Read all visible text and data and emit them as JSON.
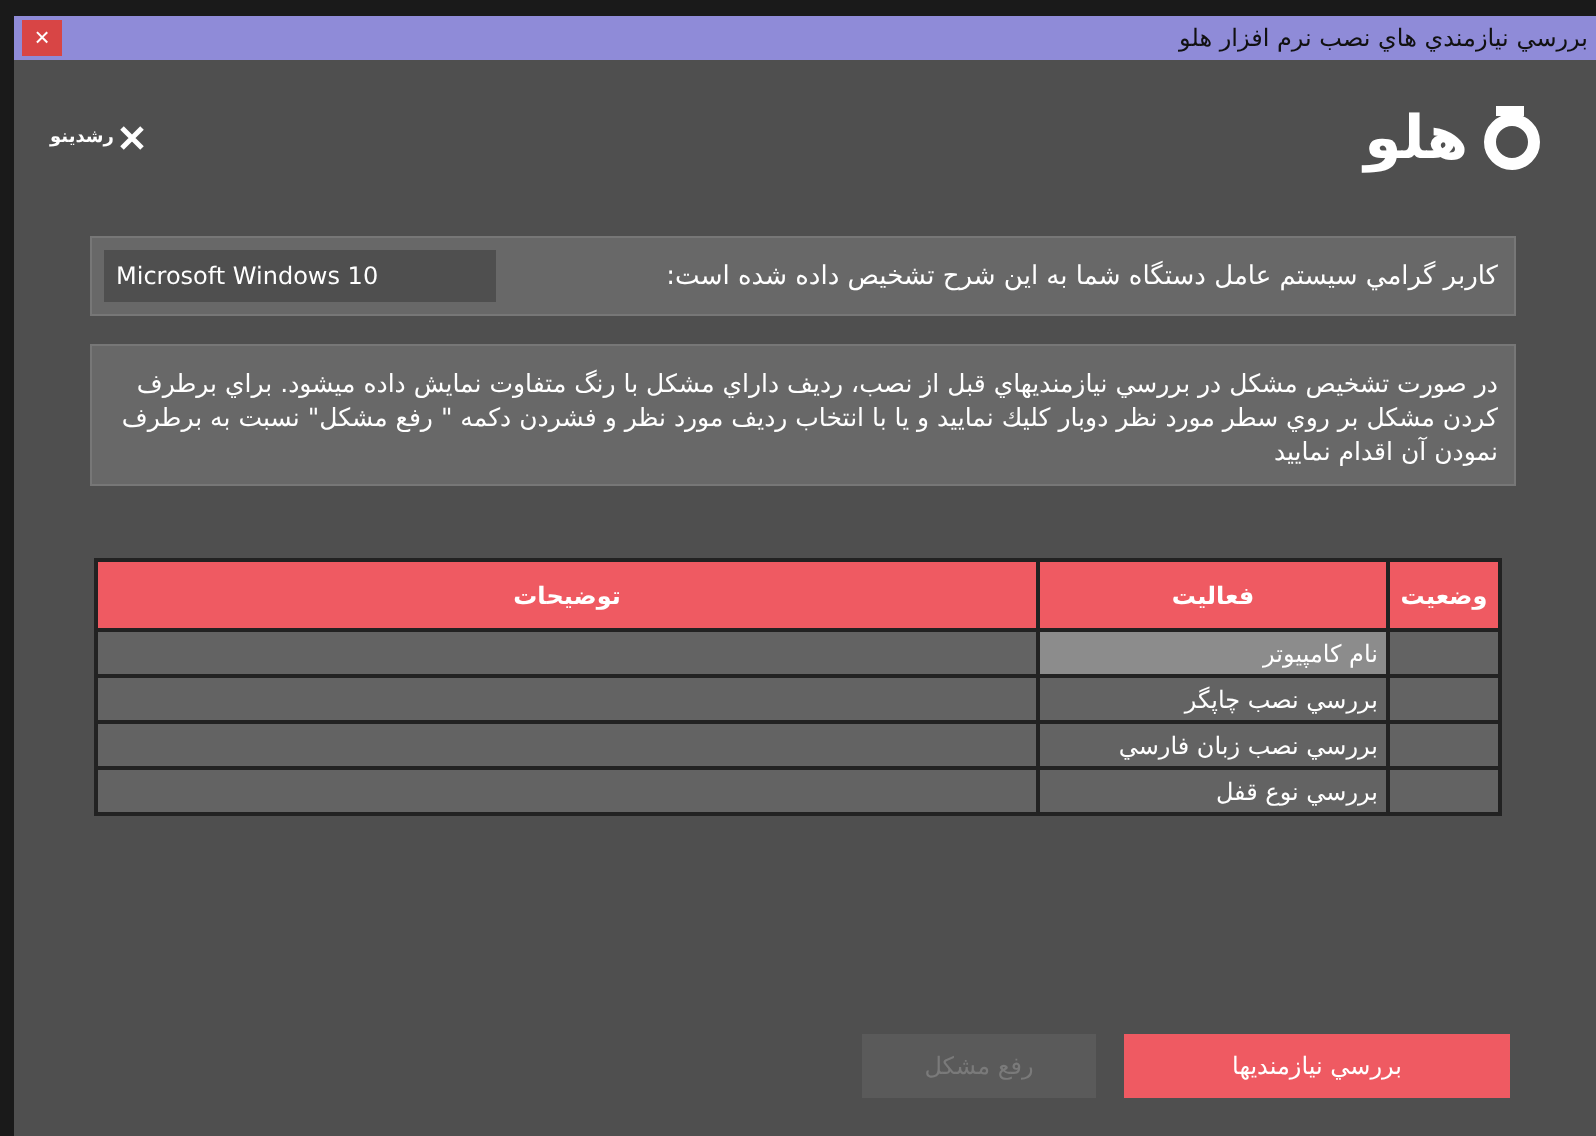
{
  "window": {
    "title": "بررسي نيازمندي هاي نصب نرم افزار هلو",
    "close": "×"
  },
  "logos": {
    "brand": "هلو",
    "partner": "رشدينو"
  },
  "os_prompt": "كاربر گرامي سيستم عامل دستگاه شما به اين شرح تشخيص داده شده است:",
  "os_value": "Microsoft Windows 10",
  "notice": "در صورت تشخيص مشكل در بررسي نيازمنديهاي قبل از نصب، رديف داراي مشكل با رنگ متفاوت نمايش داده ميشود. براي برطرف كردن مشكل بر روي سطر  مورد نظر دوبار كليك نماييد و يا با انتخاب رديف مورد نظر و فشردن دكمه \" رفع مشكل\" نسبت به برطرف نمودن آن اقدام نماييد",
  "table": {
    "columns": [
      "وضعيت",
      "فعاليت",
      "توضيحات"
    ],
    "rows": [
      {
        "activity": "نام كامپيوتر",
        "selected": true
      },
      {
        "activity": "بررسي نصب چاپگر",
        "selected": false
      },
      {
        "activity": "بررسي نصب زبان فارسي",
        "selected": false
      },
      {
        "activity": "بررسي نوع قفل",
        "selected": false
      }
    ]
  },
  "buttons": [
    {
      "label": "بررسي نيازمنديها",
      "disabled": false
    },
    {
      "label": "رفع مشكل",
      "disabled": true
    }
  ]
}
